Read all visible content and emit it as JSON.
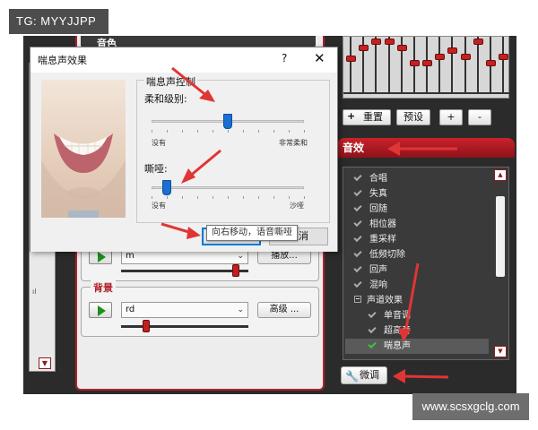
{
  "watermarks": {
    "top": "TG: MYYJJPP",
    "bottom": "www.scsxgclg.com"
  },
  "app": {
    "tone_label": "音色",
    "group1": {
      "combo_value": "m",
      "advanced_label": "播放...",
      "slider_value": 0.9
    },
    "background_group": {
      "title": "背景",
      "combo_value": "rd",
      "advanced_label": "高级 ...",
      "slider_value": 0.2
    }
  },
  "equalizer": {
    "reset_label": "重置",
    "preset_label": "预设",
    "plus_label": "+",
    "minus_label": "-",
    "knob_levels": [
      0.4,
      0.15,
      0.0,
      0.0,
      0.15,
      0.5,
      0.5,
      0.35,
      0.2,
      0.35,
      0.0,
      0.5,
      0.35
    ]
  },
  "effects": {
    "header": "音效",
    "items": [
      {
        "label": "合唱",
        "type": "item"
      },
      {
        "label": "失真",
        "type": "item"
      },
      {
        "label": "回随",
        "type": "item"
      },
      {
        "label": "相位器",
        "type": "item"
      },
      {
        "label": "重采样",
        "type": "item"
      },
      {
        "label": "低频切除",
        "type": "item"
      },
      {
        "label": "回声",
        "type": "item"
      },
      {
        "label": "混响",
        "type": "item"
      },
      {
        "label": "声道效果",
        "type": "group"
      },
      {
        "label": "单音调",
        "type": "sub"
      },
      {
        "label": "超高音",
        "type": "sub"
      },
      {
        "label": "喘息声",
        "type": "selected"
      }
    ],
    "tune_label": "微调"
  },
  "dialog": {
    "title": "喘息声效果",
    "help": "?",
    "close": "✕",
    "group_label": "喘息声控制",
    "softness_label": "柔和级别:",
    "softness_min": "没有",
    "softness_max": "非常柔和",
    "softness_value": 0.5,
    "hoarse_label": "嘶哑:",
    "hoarse_min": "没有",
    "hoarse_max": "沙哑",
    "hoarse_value": 0.1,
    "tooltip": "向右移动，语音嘶哑",
    "ok_label": "好的",
    "cancel_label": "取消"
  },
  "colors": {
    "accent_red": "#c8222b",
    "arrow_red": "#e03535",
    "thumb_blue": "#1a6fd3"
  },
  "icons": [
    "play-icon",
    "chevron-down-icon",
    "wrench-icon",
    "check-icon",
    "close-icon",
    "help-icon"
  ]
}
